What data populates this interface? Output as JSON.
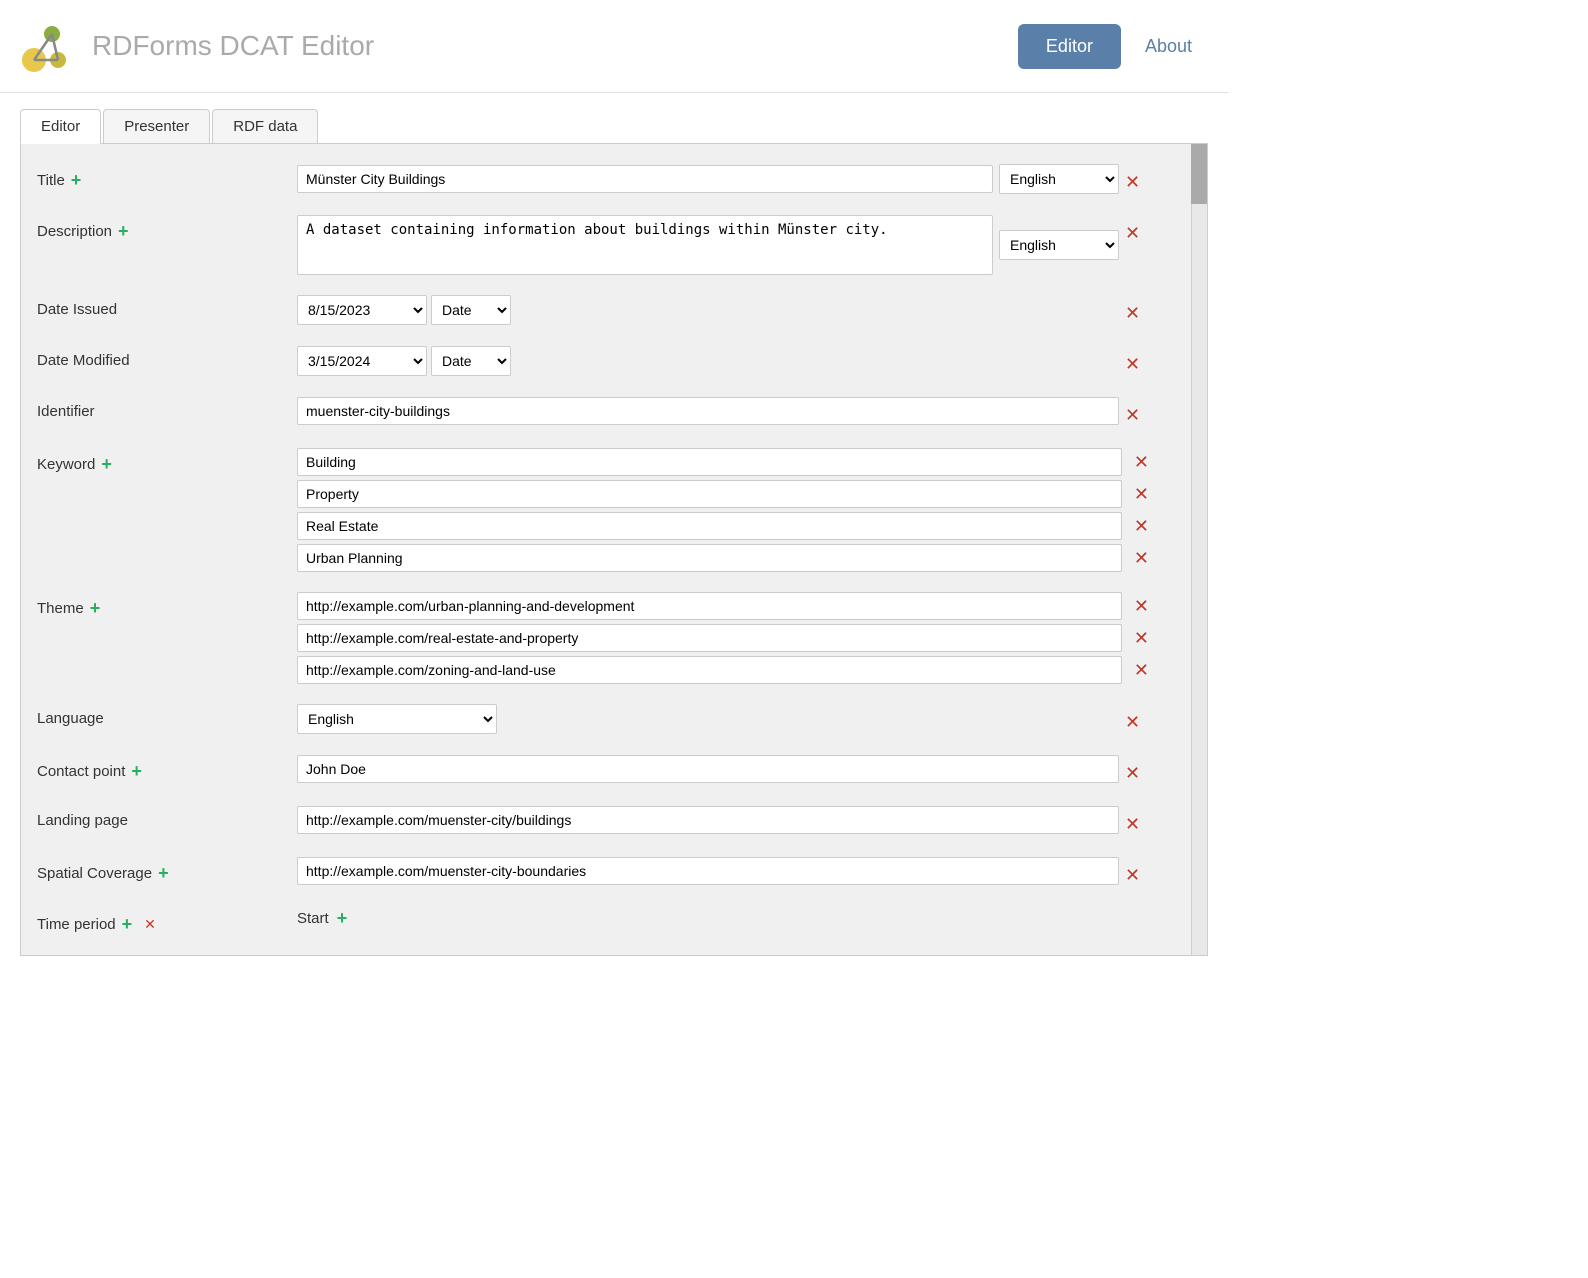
{
  "app": {
    "title": "RDForms DCAT Editor",
    "nav": {
      "editor_label": "Editor",
      "about_label": "About"
    }
  },
  "tabs": {
    "items": [
      {
        "label": "Editor",
        "active": true
      },
      {
        "label": "Presenter",
        "active": false
      },
      {
        "label": "RDF data",
        "active": false
      }
    ]
  },
  "fields": {
    "title": {
      "label": "Title",
      "value": "Münster City Buildings",
      "language": "English"
    },
    "description": {
      "label": "Description",
      "value": "A dataset containing information about buildings within Münster city.",
      "language": "English"
    },
    "date_issued": {
      "label": "Date Issued",
      "value": "8/15/2023",
      "type": "Date"
    },
    "date_modified": {
      "label": "Date Modified",
      "value": "3/15/2024",
      "type": "Date"
    },
    "identifier": {
      "label": "Identifier",
      "value": "muenster-city-buildings"
    },
    "keyword": {
      "label": "Keyword",
      "values": [
        "Building",
        "Property",
        "Real Estate",
        "Urban Planning"
      ]
    },
    "theme": {
      "label": "Theme",
      "values": [
        "http://example.com/urban-planning-and-development",
        "http://example.com/real-estate-and-property",
        "http://example.com/zoning-and-land-use"
      ]
    },
    "language": {
      "label": "Language",
      "value": "English"
    },
    "contact_point": {
      "label": "Contact point",
      "value": "John Doe"
    },
    "landing_page": {
      "label": "Landing page",
      "value": "http://example.com/muenster-city/buildings"
    },
    "spatial_coverage": {
      "label": "Spatial Coverage",
      "value": "http://example.com/muenster-city-boundaries"
    },
    "time_period": {
      "label": "Time period",
      "start_label": "Start"
    }
  },
  "icons": {
    "add": "+",
    "remove": "✕",
    "dropdown_arrow": "▼"
  }
}
